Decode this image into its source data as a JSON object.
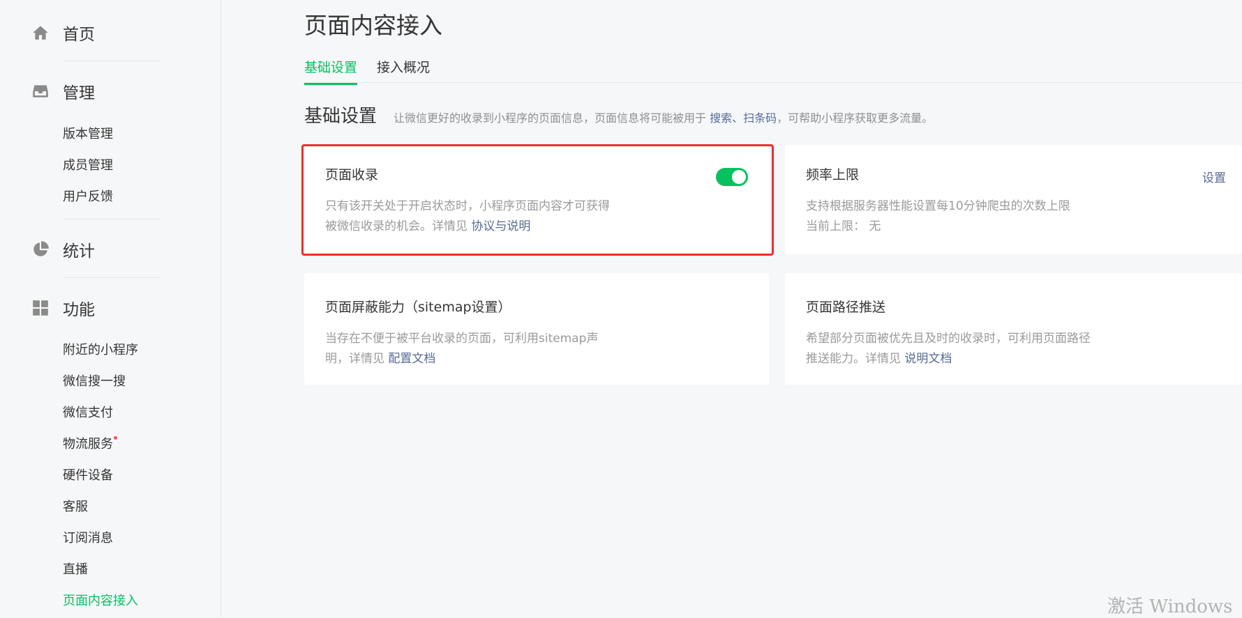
{
  "sidebar": {
    "home": {
      "label": "首页",
      "icon": "home-icon"
    },
    "manage": {
      "label": "管理",
      "icon": "inbox-icon",
      "items": [
        "版本管理",
        "成员管理",
        "用户反馈"
      ]
    },
    "stats": {
      "label": "统计",
      "icon": "pie-chart-icon"
    },
    "features": {
      "label": "功能",
      "icon": "grid-icon",
      "items": [
        "附近的小程序",
        "微信搜一搜",
        "微信支付",
        "物流服务",
        "硬件设备",
        "客服",
        "订阅消息",
        "直播",
        "页面内容接入"
      ]
    }
  },
  "main": {
    "title": "页面内容接入",
    "tabs": [
      {
        "label": "基础设置",
        "active": true
      },
      {
        "label": "接入概况",
        "active": false
      }
    ],
    "section": {
      "title": "基础设置",
      "desc_prefix": "让微信更好的收录到小程序的页面信息，页面信息将可能被用于",
      "desc_link1": "搜索",
      "desc_sep": "、",
      "desc_link2": "扫条码",
      "desc_suffix": "，可帮助小程序获取更多流量。"
    },
    "cards": {
      "page_index": {
        "title": "页面收录",
        "line1": "只有该开关处于开启状态时，小程序页面内容才可获得",
        "line2": "被微信收录的机会。详情见",
        "link": "协议与说明",
        "toggle_on": true
      },
      "rate_limit": {
        "title": "频率上限",
        "action": "设置",
        "line1": "支持根据服务器性能设置每10分钟爬虫的次数上限",
        "line2": "当前上限： 无"
      },
      "sitemap": {
        "title": "页面屏蔽能力（sitemap设置）",
        "line1": "当存在不便于被平台收录的页面，可利用sitemap声",
        "line2": "明，详情见",
        "link": "配置文档"
      },
      "push": {
        "title": "页面路径推送",
        "line1": "希望部分页面被优先且及时的收录时，可利用页面路径",
        "line2": "推送能力。详情见",
        "link": "说明文档"
      }
    }
  },
  "colors": {
    "accent": "#07c160",
    "link": "#576b95",
    "highlight": "#f02c2c",
    "dot": "#fa5151"
  },
  "watermark": "激活 Windows"
}
